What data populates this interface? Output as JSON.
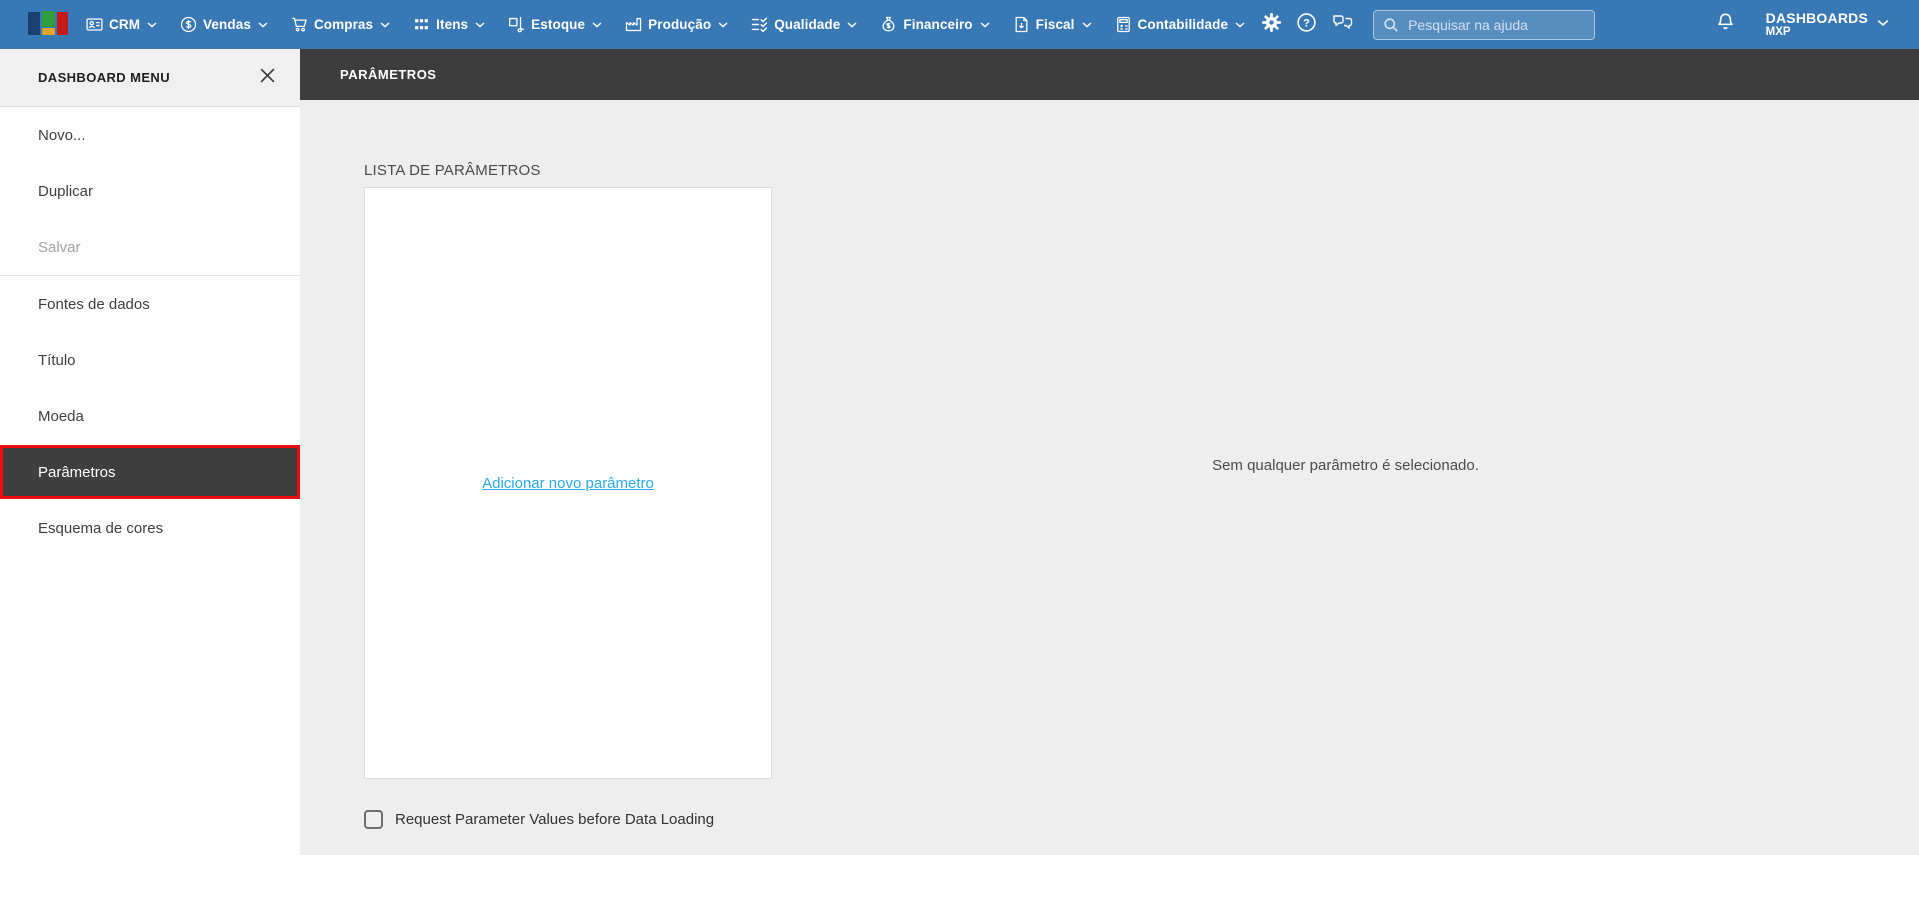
{
  "topbar": {
    "nav_items": [
      {
        "label": "CRM",
        "icon": "crm-icon"
      },
      {
        "label": "Vendas",
        "icon": "vendas-icon"
      },
      {
        "label": "Compras",
        "icon": "compras-icon"
      },
      {
        "label": "Itens",
        "icon": "itens-icon"
      },
      {
        "label": "Estoque",
        "icon": "estoque-icon"
      },
      {
        "label": "Produção",
        "icon": "producao-icon"
      },
      {
        "label": "Qualidade",
        "icon": "qualidade-icon"
      },
      {
        "label": "Financeiro",
        "icon": "financeiro-icon"
      },
      {
        "label": "Fiscal",
        "icon": "fiscal-icon"
      },
      {
        "label": "Contabilidade",
        "icon": "contabilidade-icon"
      }
    ],
    "icon_buttons": [
      "gear-icon",
      "help-icon",
      "chat-icon"
    ],
    "search": {
      "placeholder": "Pesquisar na ajuda",
      "icon": "search-icon"
    },
    "notifications_icon": "bell-icon",
    "account": {
      "title": "DASHBOARDS",
      "subtitle": "MXP"
    }
  },
  "sidebar": {
    "title": "DASHBOARD MENU",
    "close_icon": "close-icon",
    "items": [
      {
        "label": "Novo...",
        "state": "normal"
      },
      {
        "label": "Duplicar",
        "state": "normal"
      },
      {
        "label": "Salvar",
        "state": "disabled"
      },
      {
        "label": "Fontes de dados",
        "state": "normal"
      },
      {
        "label": "Título",
        "state": "normal"
      },
      {
        "label": "Moeda",
        "state": "normal"
      },
      {
        "label": "Parâmetros",
        "state": "active"
      },
      {
        "label": "Esquema de cores",
        "state": "normal"
      }
    ]
  },
  "content": {
    "header_title": "PARÂMETROS",
    "list_label": "LISTA DE PARÂMETROS",
    "add_link": "Adicionar novo parâmetro",
    "empty_message": "Sem qualquer parâmetro é selecionado.",
    "checkbox": {
      "label": "Request Parameter Values before Data Loading",
      "checked": false
    }
  },
  "colors": {
    "topbar_blue": "#3878b4",
    "dark_header": "#3d3d3d",
    "active_item_bg": "#3f3f3f",
    "active_item_border": "#ee0d0d",
    "link_blue": "#2ba9e1",
    "content_bg": "#eeeeee",
    "logo_navy": "#1c3f6e",
    "logo_green": "#2f9e3f",
    "logo_orange": "#e2a32b",
    "logo_red": "#c51a1a"
  }
}
